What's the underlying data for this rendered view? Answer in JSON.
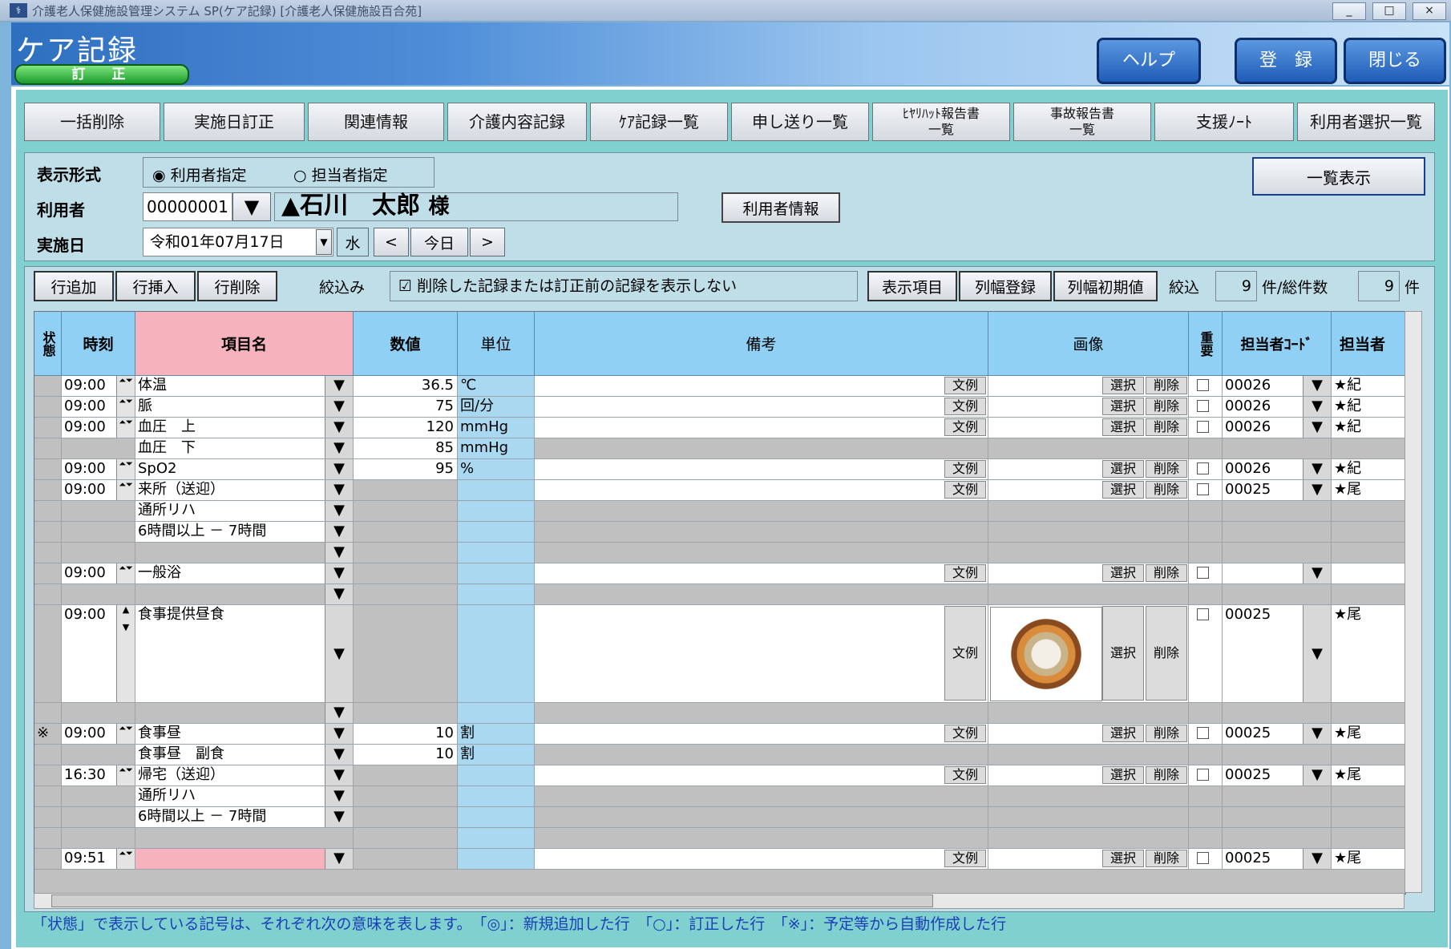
{
  "window": {
    "title": "介護老人保健施設管理システム SP(ケア記録) [介護老人保健施設百合苑]",
    "min": "_",
    "max": "□",
    "close": "×"
  },
  "header": {
    "title": "ケア記録",
    "mode": "訂　正",
    "help": "ヘルプ",
    "register": "登　録",
    "close": "閉じる"
  },
  "tabs": [
    "一括削除",
    "実施日訂正",
    "関連情報",
    "介護内容記録",
    "ｹｱ記録一覧",
    "申し送り一覧",
    "ﾋﾔﾘﾊｯﾄ報告書\n一覧",
    "事故報告書\n一覧",
    "支援ﾉｰﾄ",
    "利用者選択一覧"
  ],
  "filter": {
    "display_label": "表示形式",
    "radio1": "利用者指定",
    "radio2": "担当者指定",
    "user_label": "利用者",
    "user_code": "00000001",
    "user_name": "▲石川　太郎",
    "honorific": "様",
    "user_info_btn": "利用者情報",
    "date_label": "実施日",
    "date": "令和01年07月17日",
    "weekday": "水",
    "prev": "<",
    "today": "今日",
    "next": ">",
    "list_btn": "一覧表示"
  },
  "toolbar": {
    "add": "行追加",
    "insert": "行挿入",
    "delete": "行削除",
    "narrow_label": "絞込み",
    "narrow_text": "削除した記録または訂正前の記録を表示しない",
    "display_items": "表示項目",
    "col_reg": "列幅登録",
    "col_init": "列幅初期値",
    "count_label": "絞込",
    "count": "9",
    "count_sep": "件/総件数",
    "total": "9",
    "unit": "件"
  },
  "grid_headers": {
    "status": "状態",
    "time": "時刻",
    "item": "項目名",
    "value": "数値",
    "unit": "単位",
    "note": "備考",
    "image": "画像",
    "important": "重要",
    "staff_code": "担当者ｺｰﾄﾞ",
    "staff": "担当者"
  },
  "rows": [
    {
      "time": "09:00",
      "item": "体温",
      "value": "36.5",
      "unit": "℃",
      "note": "文例",
      "code": "00026",
      "staff": "★紀"
    },
    {
      "time": "09:00",
      "item": "脈",
      "value": "75",
      "unit": "回/分",
      "note": "文例",
      "code": "00026",
      "staff": "★紀"
    },
    {
      "time": "09:00",
      "item": "血圧　上",
      "value": "120",
      "unit": "mmHg",
      "note": "文例",
      "code": "00026",
      "staff": "★紀"
    },
    {
      "time": "",
      "item": "血圧　下",
      "value": "85",
      "unit": "mmHg",
      "note": "",
      "code": "",
      "staff": ""
    },
    {
      "time": "09:00",
      "item": "SpO2",
      "value": "95",
      "unit": "%",
      "note": "文例",
      "code": "00026",
      "staff": "★紀"
    },
    {
      "time": "09:00",
      "item": "来所（送迎）",
      "value": "",
      "unit": "",
      "note": "文例",
      "code": "00025",
      "staff": "★尾"
    },
    {
      "time": "",
      "item": "通所リハ",
      "value": "",
      "unit": "",
      "note": "",
      "code": "",
      "staff": ""
    },
    {
      "time": "",
      "item": " 6時間以上 －  7時間",
      "value": "",
      "unit": "",
      "note": "",
      "code": "",
      "staff": ""
    },
    {
      "time": "",
      "item": "",
      "value": "",
      "unit": "",
      "note": "",
      "code": "",
      "staff": ""
    },
    {
      "time": "09:00",
      "item": "一般浴",
      "value": "",
      "unit": "",
      "note": "文例",
      "code": "",
      "staff": ""
    },
    {
      "time": "",
      "item": "",
      "value": "",
      "unit": "",
      "note": "",
      "code": "",
      "staff": ""
    },
    {
      "time": "09:00",
      "item": "食事提供昼食",
      "value": "",
      "unit": "",
      "note": "文例",
      "code": "00025",
      "staff": "★尾"
    },
    {
      "time": "",
      "item": "",
      "value": "",
      "unit": "",
      "note": "",
      "code": "",
      "staff": ""
    },
    {
      "status": "※",
      "time": "09:00",
      "item": "食事昼",
      "value": "10",
      "unit": "割",
      "note": "文例",
      "code": "00025",
      "staff": "★尾"
    },
    {
      "time": "",
      "item": "食事昼　副食",
      "value": "10",
      "unit": "割",
      "note": "",
      "code": "",
      "staff": ""
    },
    {
      "time": "16:30",
      "item": "帰宅（送迎）",
      "value": "",
      "unit": "",
      "note": "文例",
      "code": "00025",
      "staff": "★尾"
    },
    {
      "time": "",
      "item": "通所リハ",
      "value": "",
      "unit": "",
      "note": "",
      "code": "",
      "staff": ""
    },
    {
      "time": "",
      "item": " 6時間以上 －  7時間",
      "value": "",
      "unit": "",
      "note": "",
      "code": "",
      "staff": ""
    },
    {
      "time": "",
      "item": "",
      "value": "",
      "unit": "",
      "note": "",
      "code": "",
      "staff": ""
    },
    {
      "time": "09:51",
      "item": "",
      "value": "",
      "unit": "",
      "note": "文例",
      "code": "00025",
      "staff": "★尾"
    }
  ],
  "img_btns": {
    "select": "選択",
    "delete": "削除",
    "example": "文例"
  },
  "status_bar": "「状態」で表示している記号は、それぞれ次の意味を表します。　「◎」：新規追加した行　「○」：訂正した行　「※」：予定等から自動作成した行",
  "colors": {
    "accent": "#1f5cb8",
    "header_pink": "#f7b3bd",
    "header_blue": "#8fd0f4",
    "panel": "#bfdee8"
  }
}
